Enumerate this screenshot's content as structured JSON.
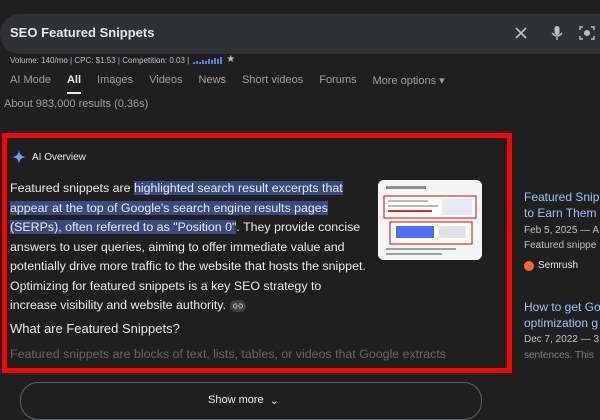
{
  "search": {
    "query": "SEO Featured Snippets",
    "icons": [
      "close-icon",
      "mic-icon",
      "lens-icon"
    ]
  },
  "keyword_stats": {
    "text": "Volume: 140/mo | CPC: $1.53 | Competition: 0.03 |",
    "trend": [
      2,
      3,
      2,
      4,
      3,
      5,
      4,
      6,
      5,
      7
    ],
    "star_icon": "star-icon"
  },
  "tabs": [
    {
      "label": "AI Mode"
    },
    {
      "label": "All"
    },
    {
      "label": "Images"
    },
    {
      "label": "Videos"
    },
    {
      "label": "News"
    },
    {
      "label": "Short videos"
    },
    {
      "label": "Forums"
    },
    {
      "label": "More options ▾"
    }
  ],
  "active_tab": "All",
  "results_count": "About 983,000 results (0.36s)",
  "ai_overview": {
    "header": "AI Overview",
    "para_start": "Featured snippets are ",
    "highlight": "highlighted search result excerpts that appear at the top of Google's search engine results pages (SERPs), often referred to as \"Position 0\"",
    "para_rest": ". They provide concise answers to user queries, aiming to offer immediate value and potentially drive more traffic to the website that hosts the snippet. Optimizing for featured snippets is a key SEO strategy to increase visibility and website authority.",
    "section_heading": "What are Featured Snippets?",
    "faded_line": "Featured snippets are blocks of text, lists, tables, or videos that Google extracts",
    "show_more": "Show more",
    "accent_color": "#ff0000"
  },
  "side_results": [
    {
      "title_line1": "Featured Snipp",
      "title_line2": "to Earn Them -",
      "date_line": "Feb 5, 2025 — A",
      "snippet_line": "Featured snippe",
      "source": "Semrush"
    },
    {
      "title_line1": "How to get Go",
      "title_line2": "optimization g",
      "date_line": "Dec 7, 2022 — 3.",
      "snippet_line": "sentences. This"
    }
  ]
}
